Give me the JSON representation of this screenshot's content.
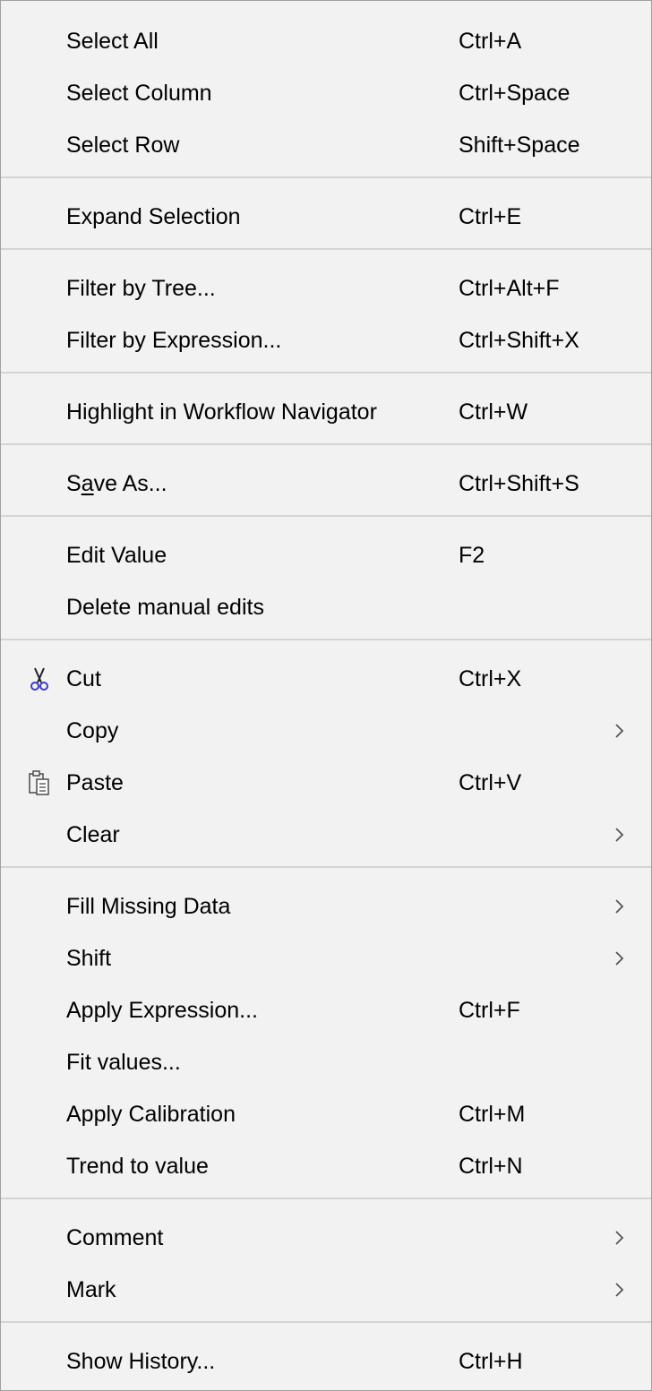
{
  "menu": {
    "select_all": {
      "label": "Select All",
      "shortcut": "Ctrl+A"
    },
    "select_column": {
      "label": "Select Column",
      "shortcut": "Ctrl+Space"
    },
    "select_row": {
      "label": "Select Row",
      "shortcut": "Shift+Space"
    },
    "expand_selection": {
      "label": "Expand Selection",
      "shortcut": "Ctrl+E"
    },
    "filter_by_tree": {
      "label": "Filter by Tree...",
      "shortcut": "Ctrl+Alt+F"
    },
    "filter_by_expression": {
      "label": "Filter by Expression...",
      "shortcut": "Ctrl+Shift+X"
    },
    "highlight_navigator": {
      "label": "Highlight in Workflow Navigator",
      "shortcut": "Ctrl+W"
    },
    "save_as": {
      "label_pre": "S",
      "label_underlined": "a",
      "label_post": "ve As...",
      "shortcut": "Ctrl+Shift+S"
    },
    "edit_value": {
      "label": "Edit Value",
      "shortcut": "F2"
    },
    "delete_manual_edits": {
      "label": "Delete manual edits"
    },
    "cut": {
      "label": "Cut",
      "shortcut": "Ctrl+X",
      "icon": "scissors-icon"
    },
    "copy": {
      "label": "Copy"
    },
    "paste": {
      "label": "Paste",
      "shortcut": "Ctrl+V",
      "icon": "clipboard-icon"
    },
    "clear": {
      "label": "Clear"
    },
    "fill_missing_data": {
      "label": "Fill Missing Data"
    },
    "shift": {
      "label": "Shift"
    },
    "apply_expression": {
      "label": "Apply Expression...",
      "shortcut": "Ctrl+F"
    },
    "fit_values": {
      "label": "Fit values..."
    },
    "apply_calibration": {
      "label": "Apply Calibration",
      "shortcut": "Ctrl+M"
    },
    "trend_to_value": {
      "label": "Trend to value",
      "shortcut": "Ctrl+N"
    },
    "comment": {
      "label": "Comment"
    },
    "mark": {
      "label": "Mark"
    },
    "show_history": {
      "label": "Show History...",
      "shortcut": "Ctrl+H"
    }
  },
  "colors": {
    "menu_background": "#f2f2f2",
    "separator": "#d4d4d4",
    "border": "#a0a0a0",
    "scissors_accent": "#3c3cc8",
    "chevron": "#555555"
  }
}
